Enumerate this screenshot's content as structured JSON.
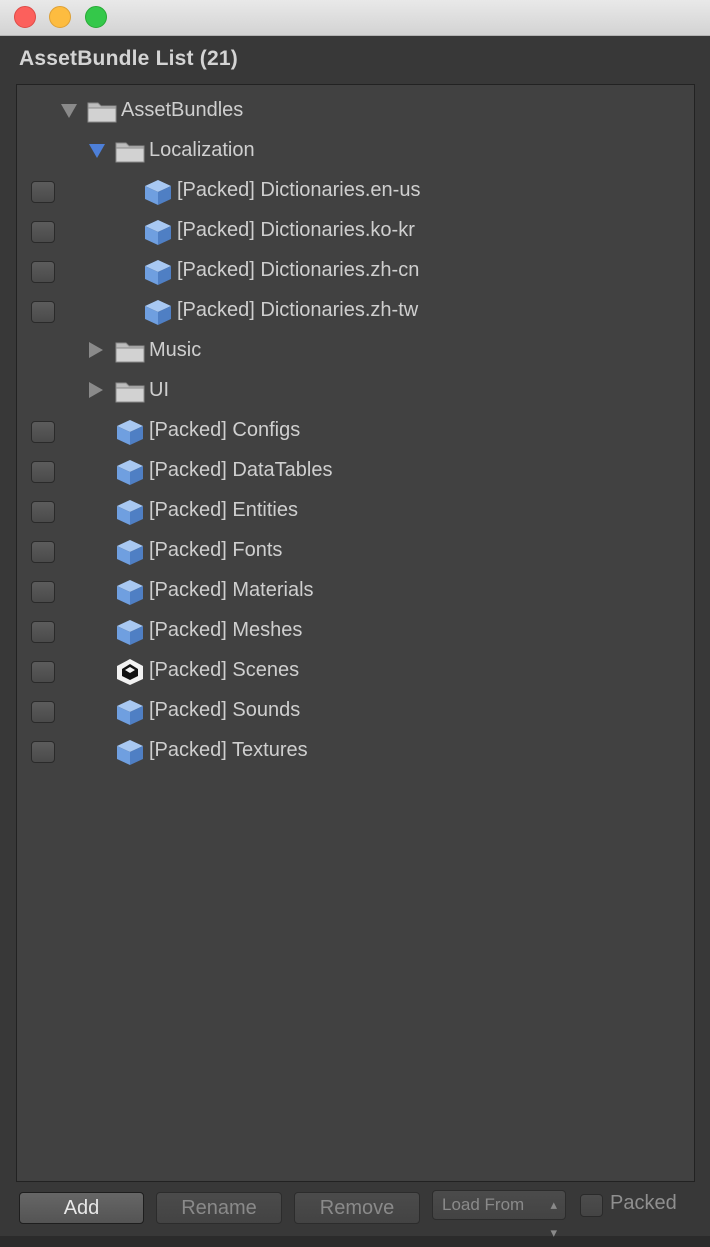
{
  "panel": {
    "title": "AssetBundle List (21)"
  },
  "tree": [
    {
      "label": "AssetBundles",
      "type": "folder",
      "indent": 0,
      "expander": "down",
      "checkbox": false
    },
    {
      "label": "Localization",
      "type": "folder",
      "indent": 1,
      "expander": "down-active",
      "checkbox": false
    },
    {
      "label": "[Packed] Dictionaries.en-us",
      "type": "bundle",
      "indent": 2,
      "expander": "none",
      "checkbox": true
    },
    {
      "label": "[Packed] Dictionaries.ko-kr",
      "type": "bundle",
      "indent": 2,
      "expander": "none",
      "checkbox": true
    },
    {
      "label": "[Packed] Dictionaries.zh-cn",
      "type": "bundle",
      "indent": 2,
      "expander": "none",
      "checkbox": true
    },
    {
      "label": "[Packed] Dictionaries.zh-tw",
      "type": "bundle",
      "indent": 2,
      "expander": "none",
      "checkbox": true
    },
    {
      "label": "Music",
      "type": "folder",
      "indent": 1,
      "expander": "right",
      "checkbox": false
    },
    {
      "label": "UI",
      "type": "folder",
      "indent": 1,
      "expander": "right",
      "checkbox": false
    },
    {
      "label": "[Packed] Configs",
      "type": "bundle",
      "indent": 1,
      "expander": "none",
      "checkbox": true
    },
    {
      "label": "[Packed] DataTables",
      "type": "bundle",
      "indent": 1,
      "expander": "none",
      "checkbox": true
    },
    {
      "label": "[Packed] Entities",
      "type": "bundle",
      "indent": 1,
      "expander": "none",
      "checkbox": true
    },
    {
      "label": "[Packed] Fonts",
      "type": "bundle",
      "indent": 1,
      "expander": "none",
      "checkbox": true
    },
    {
      "label": "[Packed] Materials",
      "type": "bundle",
      "indent": 1,
      "expander": "none",
      "checkbox": true
    },
    {
      "label": "[Packed] Meshes",
      "type": "bundle",
      "indent": 1,
      "expander": "none",
      "checkbox": true
    },
    {
      "label": "[Packed] Scenes",
      "type": "unity",
      "indent": 1,
      "expander": "none",
      "checkbox": true
    },
    {
      "label": "[Packed] Sounds",
      "type": "bundle",
      "indent": 1,
      "expander": "none",
      "checkbox": true
    },
    {
      "label": "[Packed] Textures",
      "type": "bundle",
      "indent": 1,
      "expander": "none",
      "checkbox": true
    }
  ],
  "icons": {
    "folder": "folder-icon",
    "bundle": "cube-icon",
    "unity": "unity-logo-icon"
  },
  "toolbar": {
    "add_label": "Add",
    "rename_label": "Rename",
    "remove_label": "Remove",
    "load_from_value": "Load From",
    "packed_label": "Packed"
  },
  "colors": {
    "expander_active": "#4d7fd8",
    "cube_blue": "#6f9fe0"
  }
}
